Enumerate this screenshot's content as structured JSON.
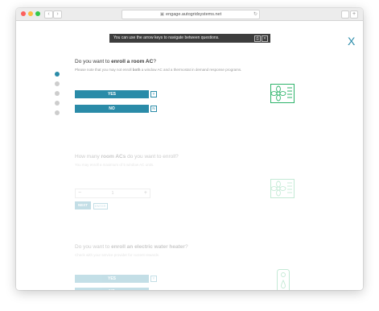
{
  "browser": {
    "url": "engage.autogridsystems.net",
    "back_glyph": "‹",
    "forward_glyph": "›",
    "reload_glyph": "↻",
    "new_tab_glyph": "+"
  },
  "tooltip": {
    "text": "You can use the arrow keys to navigate between questions."
  },
  "close_glyph": "X",
  "accent_color": "#2a8ba8",
  "icon_color": "#2db36a",
  "questions": [
    {
      "prefix": "Do you want to ",
      "bold": "enroll a room AC",
      "suffix": "?",
      "note_prefix": "Please note that you may not enroll ",
      "note_bold": "both",
      "note_suffix": " a window AC and a thermostat in demand response programs.",
      "yes_label": "YES",
      "yes_key": "Y",
      "no_label": "NO",
      "no_key": "N",
      "icon": "ac-unit-icon"
    },
    {
      "prefix": "How many ",
      "bold": "room ACs",
      "suffix": " do you want to enroll?",
      "note": "You may enroll a maximum of 5 window AC units.",
      "minus": "−",
      "value": "1",
      "plus": "+",
      "next_label": "NEXT",
      "enter_label": "ENTER",
      "icon": "ac-unit-icon"
    },
    {
      "prefix": "Do you want to ",
      "bold": "enroll an electric water heater",
      "suffix": "?",
      "note": "Check with your service provider for current rewards.",
      "yes_label": "YES",
      "yes_key": "Y",
      "no_label": "NO",
      "icon": "water-heater-icon"
    }
  ]
}
